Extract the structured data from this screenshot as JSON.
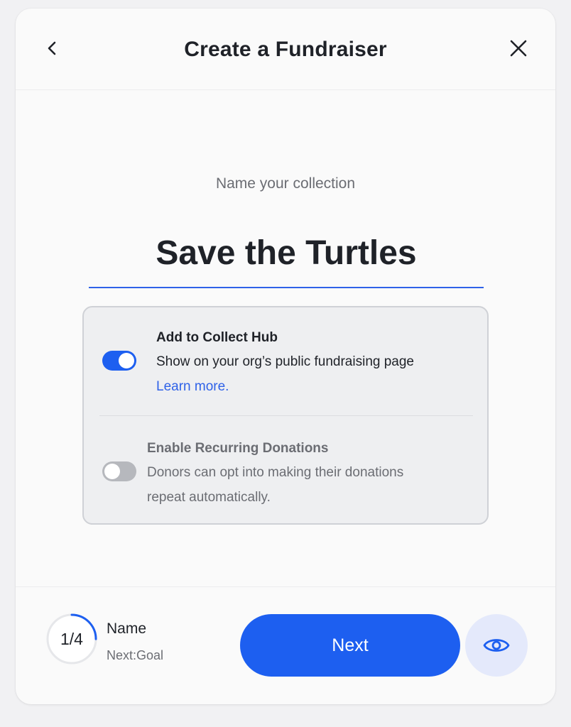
{
  "header": {
    "title": "Create a Fundraiser",
    "back_icon": "chevron-left-icon",
    "close_icon": "close-icon"
  },
  "form": {
    "prompt": "Name your collection",
    "collection_name": "Save the Turtles"
  },
  "options": [
    {
      "title": "Add to Collect Hub",
      "description": "Show on your org’s public fundraising page",
      "link": "Learn more.",
      "enabled": true
    },
    {
      "title": "Enable Recurring Donations",
      "description_line1": "Donors can opt into making their donations",
      "description_line2": "repeat automatically.",
      "enabled": false
    }
  ],
  "footer": {
    "step_count": "1/4",
    "progress_fraction": 0.25,
    "step_name": "Name",
    "next_step": "Next:Goal",
    "next_label": "Next",
    "preview_icon": "eye-icon"
  },
  "colors": {
    "accent": "#1d5ff0",
    "text_primary": "#1f2228",
    "text_secondary": "#6b6d73",
    "toggle_off": "#b6b8bd",
    "preview_bg": "#e4e9fb"
  }
}
